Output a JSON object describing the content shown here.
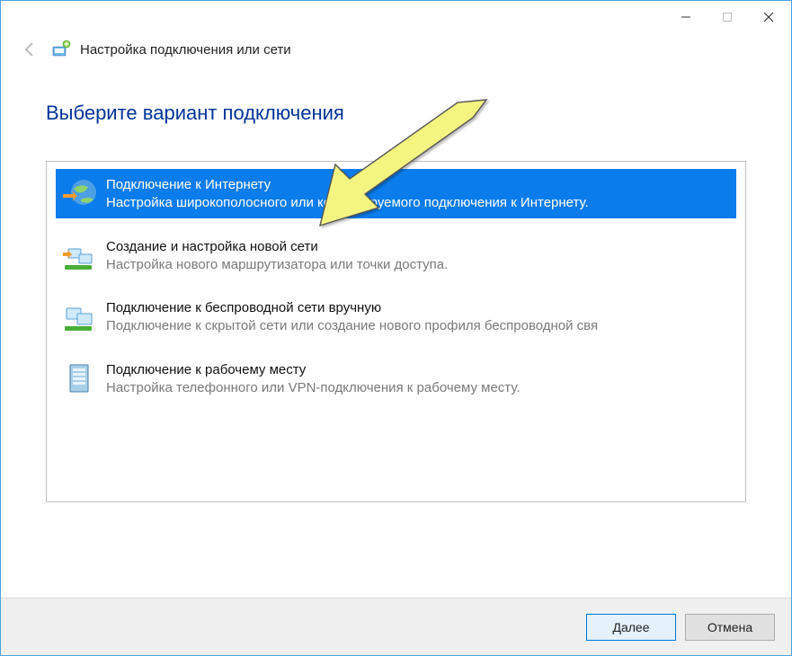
{
  "window": {
    "wizard_title": "Настройка подключения или сети"
  },
  "page": {
    "heading": "Выберите вариант подключения"
  },
  "options": [
    {
      "title": "Подключение к Интернету",
      "desc": "Настройка широкополосного или коммутируемого подключения к Интернету."
    },
    {
      "title": "Создание и настройка новой сети",
      "desc": "Настройка нового маршрутизатора или точки доступа."
    },
    {
      "title": "Подключение к беспроводной сети вручную",
      "desc": "Подключение к скрытой сети или создание нового профиля беспроводной свя"
    },
    {
      "title": "Подключение к рабочему месту",
      "desc": "Настройка телефонного или VPN-подключения к рабочему месту."
    }
  ],
  "footer": {
    "next": "Далее",
    "cancel": "Отмена"
  }
}
